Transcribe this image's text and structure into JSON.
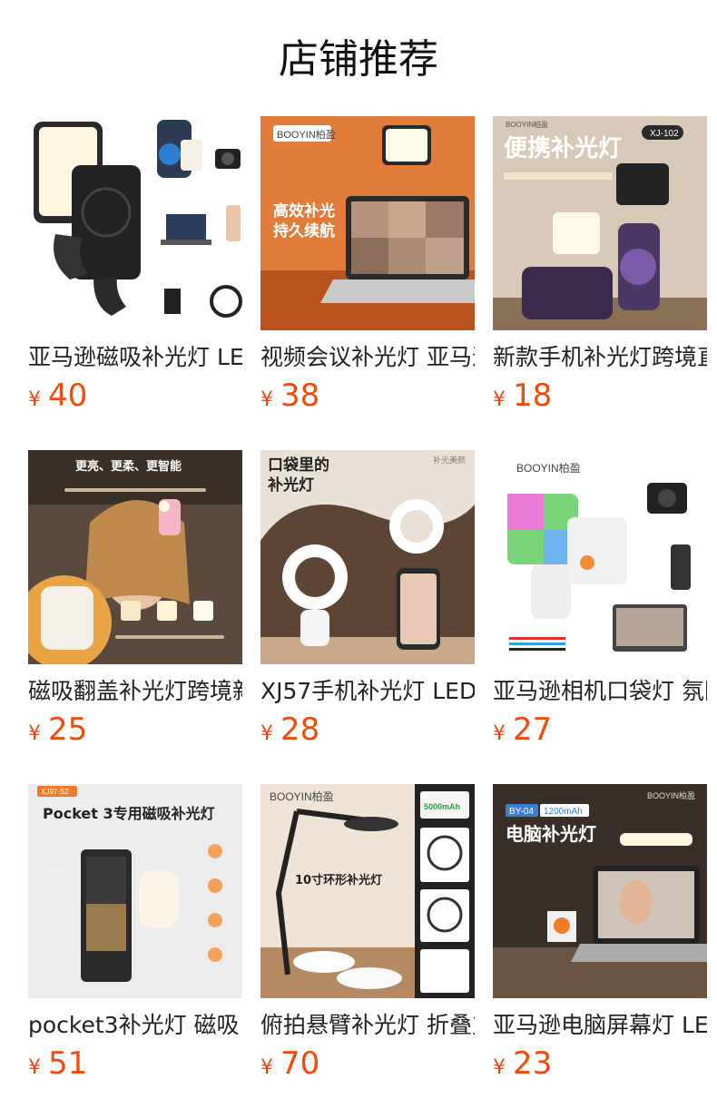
{
  "page": {
    "title": "店铺推荐"
  },
  "currency": "¥",
  "products": [
    {
      "name": "亚马逊磁吸补光灯 LED",
      "price": "40",
      "img_text": []
    },
    {
      "name": "视频会议补光灯 亚马逊",
      "price": "38",
      "img_text": [
        "高效补光",
        "持久续航"
      ]
    },
    {
      "name": "新款手机补光灯跨境直播",
      "price": "18",
      "img_text": [
        "便携补光灯",
        "XJ-102"
      ]
    },
    {
      "name": "磁吸翻盖补光灯跨境新款",
      "price": "25",
      "img_text": [
        "更亮、更柔、更智能"
      ]
    },
    {
      "name": "XJ57手机补光灯 LED",
      "price": "28",
      "img_text": [
        "口袋里的",
        "补光灯",
        "补光美颜"
      ]
    },
    {
      "name": "亚马逊相机口袋灯 氛围灯",
      "price": "27",
      "img_text": []
    },
    {
      "name": "pocket3补光灯 磁吸",
      "price": "51",
      "img_text": [
        "Pocket 3专用磁吸补光灯",
        "XJ97-S2"
      ]
    },
    {
      "name": "俯拍悬臂补光灯 折叠支架",
      "price": "70",
      "img_text": [
        "10寸环形补光灯",
        "5000mAh"
      ]
    },
    {
      "name": "亚马逊电脑屏幕灯 LED",
      "price": "23",
      "img_text": [
        "电脑补光灯",
        "BY-04",
        "1200mAh"
      ]
    }
  ],
  "brand": "BOOYIN柏盈",
  "colors": {
    "price": "#ef4b0a",
    "title": "#111111"
  }
}
